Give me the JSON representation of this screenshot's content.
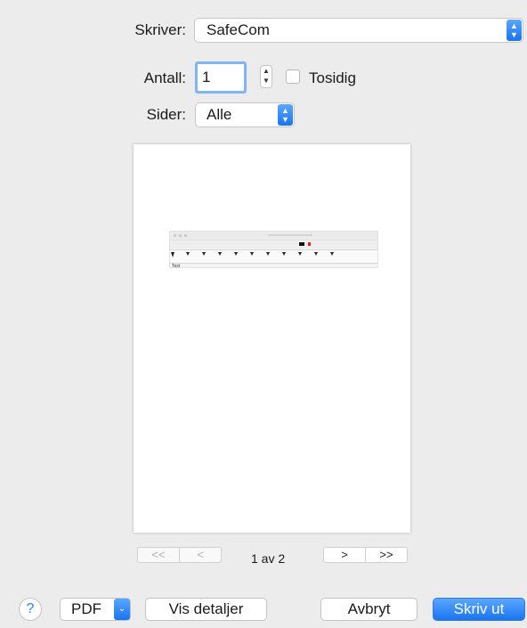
{
  "printer": {
    "label": "Skriver:",
    "value": "SafeCom"
  },
  "copies": {
    "label": "Antall:",
    "value": "1",
    "two_sided_label": "Tosidig"
  },
  "pages": {
    "label": "Sider:",
    "value": "Alle"
  },
  "preview": {
    "mini_doc_text": "Test"
  },
  "page_nav": {
    "first": "<<",
    "prev": "<",
    "next": ">",
    "last": ">>",
    "page_count": "1 av 2"
  },
  "footer": {
    "help": "?",
    "pdf": "PDF",
    "show_details": "Vis detaljer",
    "cancel": "Avbryt",
    "print": "Skriv ut"
  },
  "colors": {
    "accent": "#1a74f0",
    "background": "#ececec"
  }
}
